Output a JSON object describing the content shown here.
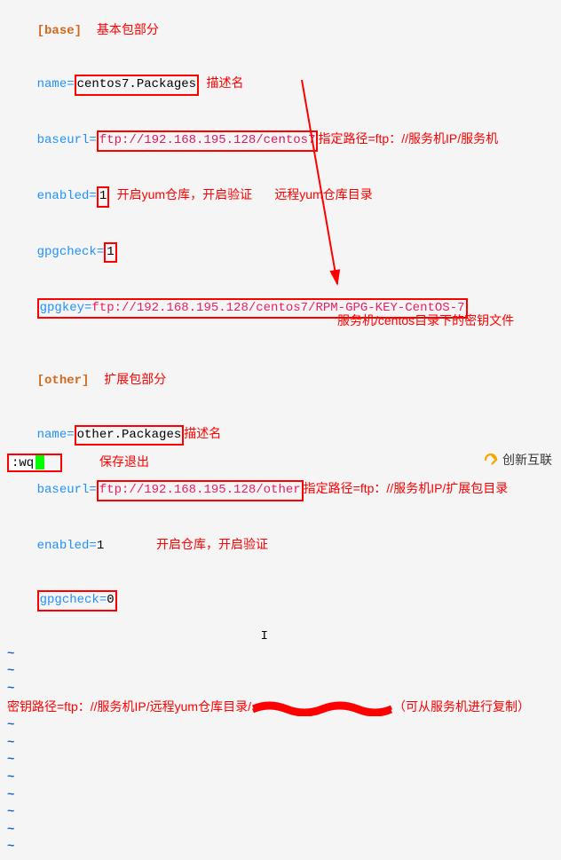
{
  "config": {
    "base_section": "[base]",
    "base_name_key": "name=",
    "base_name_val": "centos7.Packages",
    "base_url_key": "baseurl=",
    "base_url_val": "ftp://192.168.195.128/centos7",
    "enabled_key": "enabled=",
    "enabled_val": "1",
    "gpgcheck_key": "gpgcheck=",
    "gpgcheck_val_1": "1",
    "gpgkey_key": "gpgkey=",
    "gpgkey_val": "ftp://192.168.195.128/centos7/RPM-GPG-KEY-CentOS-7",
    "other_section": "[other]",
    "other_name_key": "name=",
    "other_name_val": "other.Packages",
    "other_url_key": "baseurl=",
    "other_url_val": "ftp://192.168.195.128/other",
    "gpgcheck_val_0": "0",
    "tilde": "~",
    "status_cmd": ":wq"
  },
  "annotations": {
    "base_section_note": "基本包部分",
    "name_note": "描述名",
    "baseurl_note": "指定路径=ftp：//服务机IP/服务机",
    "enable_note": "开启yum仓库，开启验证",
    "remote_yum_note": "远程yum仓库目录",
    "other_section_note": "扩展包部分",
    "other_name_note": "描述名",
    "other_baseurl_note": "指定路径=ftp：//服务机IP/扩展包目录",
    "other_enable_note": "开启仓库，开启验证",
    "gpgkey_path_note": "密钥路径=ftp：//服务机IP/远程yum仓库目录/",
    "gpgkey_tail_note": "（可从服务机进行复制）",
    "centos_dir_note": "服务机/centos目录下的密钥文件",
    "save_exit_note": "保存退出"
  },
  "logo": {
    "text": "创新互联"
  }
}
